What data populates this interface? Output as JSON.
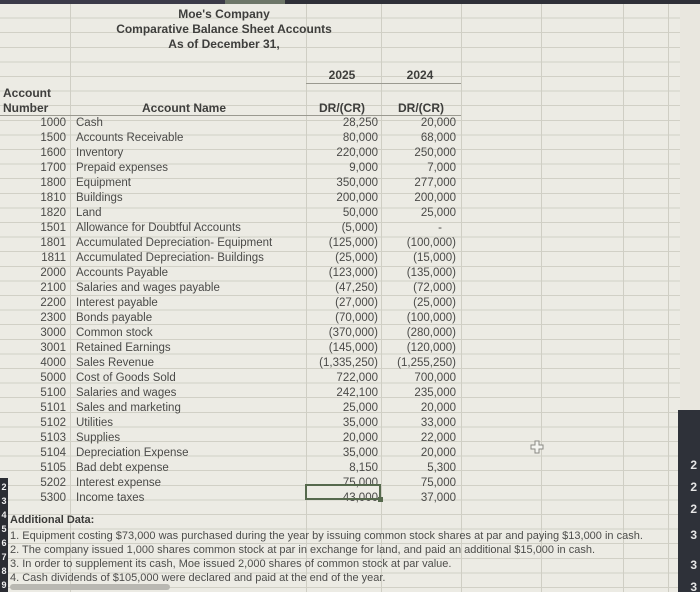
{
  "report": {
    "company": "Moe's Company",
    "title": "Comparative Balance Sheet Accounts",
    "date_line": "As of December 31,"
  },
  "headers": {
    "account": "Account",
    "number": "Number",
    "account_name": "Account Name",
    "year_current": "2025",
    "year_prior": "2024",
    "drcr_current": "DR/(CR)",
    "drcr_prior": "DR/(CR)"
  },
  "accounts": [
    {
      "number": "1000",
      "name": "Cash",
      "y2025": "28,250",
      "y2024": "20,000"
    },
    {
      "number": "1500",
      "name": "Accounts Receivable",
      "y2025": "80,000",
      "y2024": "68,000"
    },
    {
      "number": "1600",
      "name": "Inventory",
      "y2025": "220,000",
      "y2024": "250,000"
    },
    {
      "number": "1700",
      "name": "Prepaid expenses",
      "y2025": "9,000",
      "y2024": "7,000"
    },
    {
      "number": "1800",
      "name": "Equipment",
      "y2025": "350,000",
      "y2024": "277,000"
    },
    {
      "number": "1810",
      "name": "Buildings",
      "y2025": "200,000",
      "y2024": "200,000"
    },
    {
      "number": "1820",
      "name": "Land",
      "y2025": "50,000",
      "y2024": "25,000"
    },
    {
      "number": "1501",
      "name": "Allowance for Doubtful Accounts",
      "y2025": "(5,000)",
      "y2024": "-"
    },
    {
      "number": "1801",
      "name": "Accumulated Depreciation- Equipment",
      "y2025": "(125,000)",
      "y2024": "(100,000)"
    },
    {
      "number": "1811",
      "name": "Accumulated Depreciation- Buildings",
      "y2025": "(25,000)",
      "y2024": "(15,000)"
    },
    {
      "number": "2000",
      "name": "Accounts Payable",
      "y2025": "(123,000)",
      "y2024": "(135,000)"
    },
    {
      "number": "2100",
      "name": "Salaries and wages payable",
      "y2025": "(47,250)",
      "y2024": "(72,000)"
    },
    {
      "number": "2200",
      "name": "Interest payable",
      "y2025": "(27,000)",
      "y2024": "(25,000)"
    },
    {
      "number": "2300",
      "name": "Bonds payable",
      "y2025": "(70,000)",
      "y2024": "(100,000)"
    },
    {
      "number": "3000",
      "name": "Common stock",
      "y2025": "(370,000)",
      "y2024": "(280,000)"
    },
    {
      "number": "3001",
      "name": "Retained Earnings",
      "y2025": "(145,000)",
      "y2024": "(120,000)"
    },
    {
      "number": "4000",
      "name": "Sales Revenue",
      "y2025": "(1,335,250)",
      "y2024": "(1,255,250)"
    },
    {
      "number": "5000",
      "name": "Cost of Goods Sold",
      "y2025": "722,000",
      "y2024": "700,000"
    },
    {
      "number": "5100",
      "name": "Salaries and wages",
      "y2025": "242,100",
      "y2024": "235,000"
    },
    {
      "number": "5101",
      "name": "Sales and marketing",
      "y2025": "25,000",
      "y2024": "20,000"
    },
    {
      "number": "5102",
      "name": "Utilities",
      "y2025": "35,000",
      "y2024": "33,000"
    },
    {
      "number": "5103",
      "name": "Supplies",
      "y2025": "20,000",
      "y2024": "22,000"
    },
    {
      "number": "5104",
      "name": "Depreciation Expense",
      "y2025": "35,000",
      "y2024": "20,000"
    },
    {
      "number": "5105",
      "name": "Bad debt expense",
      "y2025": "8,150",
      "y2024": "5,300"
    },
    {
      "number": "5202",
      "name": "Interest expense",
      "y2025": "75,000",
      "y2024": "75,000"
    },
    {
      "number": "5300",
      "name": "Income taxes",
      "y2025": "43,000",
      "y2024": "37,000"
    }
  ],
  "additional": {
    "heading": "Additional Data:",
    "items": [
      "1. Equipment costing $73,000 was purchased during the year by issuing  common stock shares at par and paying $13,000 in cash.",
      "2. The company issued 1,000 shares common stock at par in exchange for land, and paid an additional $15,000 in cash.",
      "3. In order to supplement its cash, Moe issued 2,000 shares of common stock at par value.",
      "4. Cash dividends of $105,000 were declared and paid at the end of the year."
    ]
  },
  "row_gutter": {
    "left_digits": [
      "2",
      "3",
      "4",
      "5",
      "6",
      "7",
      "8",
      "9"
    ],
    "right_digits": [
      "2",
      "2",
      "2",
      "3",
      "3",
      "3"
    ]
  },
  "selection": {
    "cell_value": "43,000"
  }
}
